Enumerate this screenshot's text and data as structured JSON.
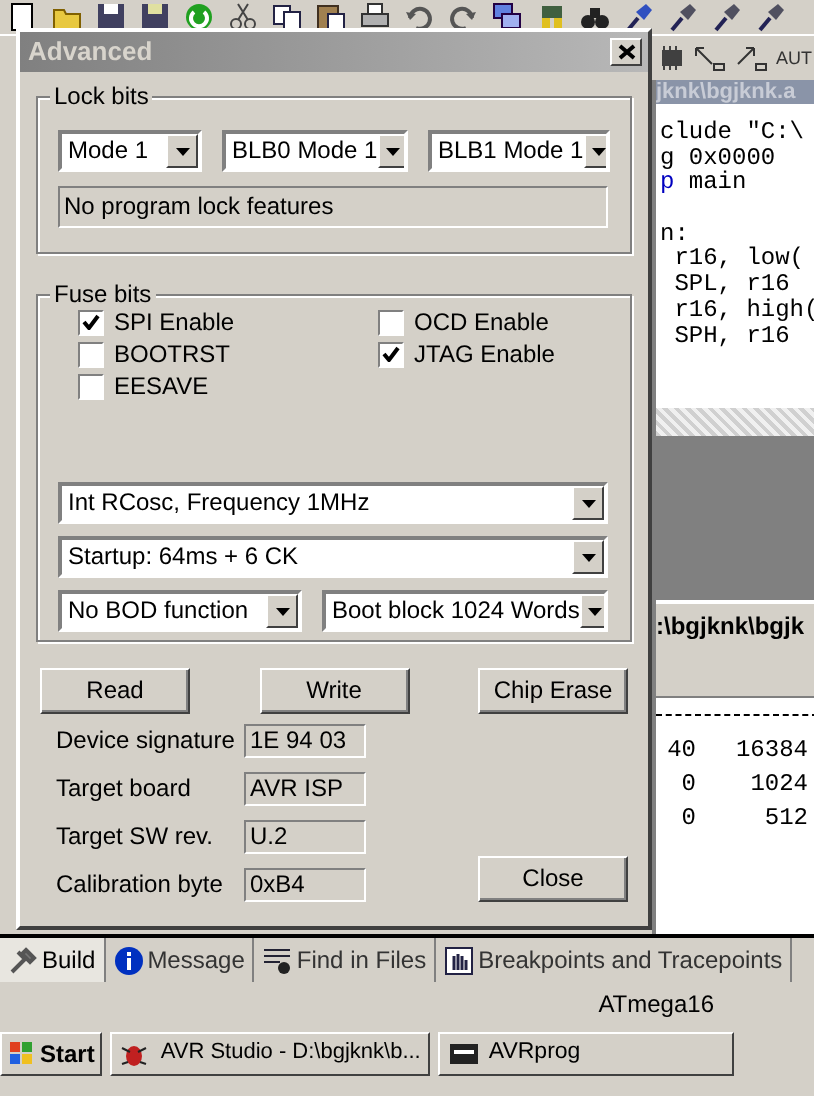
{
  "toolbar2": {
    "label": "AUT"
  },
  "editor": {
    "title": "jknk\\bgjknk.a",
    "code_lines": [
      {
        "text": "clude \"C:\\",
        "kind": "plain"
      },
      {
        "text": "g 0x0000",
        "kind": "plain"
      },
      {
        "text": "p",
        "kind": "keyword",
        "rest": " main"
      },
      {
        "text": "n:",
        "kind": "after_blank"
      },
      {
        "text": " r16, low(",
        "kind": "plain"
      },
      {
        "text": " SPL, r16",
        "kind": "plain"
      },
      {
        "text": " r16, high(",
        "kind": "plain"
      },
      {
        "text": " SPH, r16",
        "kind": "plain"
      }
    ],
    "path": ":\\bgjknk\\bgjk"
  },
  "output": {
    "rows": [
      [
        "40",
        "16384"
      ],
      [
        "0",
        "1024"
      ],
      [
        "0",
        "512"
      ]
    ]
  },
  "bottom_tabs": [
    {
      "label": "Build",
      "selected": true
    },
    {
      "label": "Message",
      "selected": false
    },
    {
      "label": "Find in Files",
      "selected": false
    },
    {
      "label": "Breakpoints and Tracepoints",
      "selected": false
    }
  ],
  "status": "ATmega16",
  "taskbar": {
    "start": "Start",
    "tasks": [
      {
        "label": "AVR Studio - D:\\bgjknk\\b..."
      },
      {
        "label": "AVRprog"
      }
    ]
  },
  "dialog": {
    "title": "Advanced",
    "lock_bits": {
      "label": "Lock bits",
      "selects": [
        "Mode 1",
        "BLB0 Mode 1",
        "BLB1 Mode 1"
      ],
      "description": "No program lock features"
    },
    "fuse_bits": {
      "label": "Fuse bits",
      "checkboxes": [
        {
          "label": "SPI Enable",
          "checked": true
        },
        {
          "label": "BOOTRST",
          "checked": false
        },
        {
          "label": "EESAVE",
          "checked": false
        },
        {
          "label": "OCD Enable",
          "checked": false
        },
        {
          "label": "JTAG Enable",
          "checked": true
        }
      ],
      "select_rows": [
        [
          "Int RCosc, Frequency 1MHz"
        ],
        [
          "Startup: 64ms + 6 CK"
        ],
        [
          "No BOD function",
          "Boot block 1024 Words"
        ]
      ]
    },
    "buttons": [
      "Read",
      "Write",
      "Chip Erase"
    ],
    "info": [
      {
        "label": "Device signature",
        "value": "1E 94 03"
      },
      {
        "label": "Target board",
        "value": "AVR ISP"
      },
      {
        "label": "Target SW rev.",
        "value": "U.2"
      },
      {
        "label": "Calibration byte",
        "value": "0xB4"
      }
    ],
    "close_button": "Close"
  }
}
